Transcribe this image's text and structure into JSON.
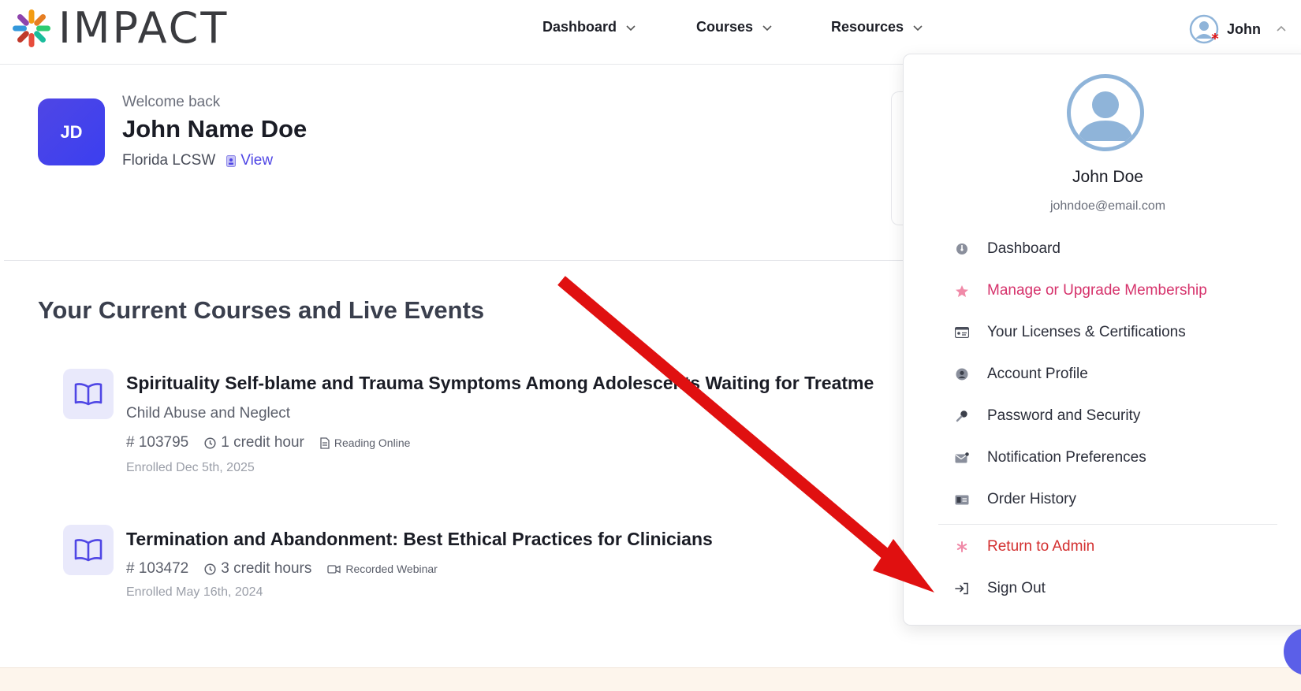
{
  "header": {
    "logo_text": "IMPACT",
    "nav": [
      {
        "label": "Dashboard"
      },
      {
        "label": "Courses"
      },
      {
        "label": "Resources"
      }
    ],
    "user_label": "John"
  },
  "welcome": {
    "initials": "JD",
    "greeting": "Welcome back",
    "name": "John Name Doe",
    "license": "Florida LCSW",
    "view_label": "View"
  },
  "courses_section": {
    "title": "Your Current Courses and Live Events",
    "courses": [
      {
        "title": "Spirituality Self-blame and Trauma Symptoms Among Adolescents Waiting for Treatme",
        "category": "Child Abuse and Neglect",
        "id": "# 103795",
        "credit": "1 credit hour",
        "format": "Reading Online",
        "enrolled": "Enrolled Dec 5th, 2025"
      },
      {
        "title": "Termination and Abandonment: Best Ethical Practices for Clinicians",
        "category": "",
        "id": "# 103472",
        "credit": "3 credit hours",
        "format": "Recorded Webinar",
        "enrolled": "Enrolled May 16th, 2024"
      }
    ]
  },
  "dropdown": {
    "name": "John Doe",
    "email": "johndoe@email.com",
    "items": [
      {
        "label": "Dashboard",
        "icon": "dashboard-icon"
      },
      {
        "label": "Manage or Upgrade Membership",
        "icon": "star-icon",
        "color": "#d6336c"
      },
      {
        "label": "Your Licenses & Certifications",
        "icon": "id-card-icon"
      },
      {
        "label": "Account Profile",
        "icon": "user-circle-icon"
      },
      {
        "label": "Password and Security",
        "icon": "key-icon"
      },
      {
        "label": "Notification Preferences",
        "icon": "envelope-icon"
      },
      {
        "label": "Order History",
        "icon": "money-bill-icon"
      },
      {
        "label": "Return to Admin",
        "icon": "asterisk-icon",
        "color": "#d32f2f"
      },
      {
        "label": "Sign Out",
        "icon": "sign-out-icon"
      }
    ]
  },
  "colors": {
    "accent": "#4f46e5",
    "arrow": "#e01010",
    "membership": "#d6336c",
    "admin": "#d32f2f"
  }
}
